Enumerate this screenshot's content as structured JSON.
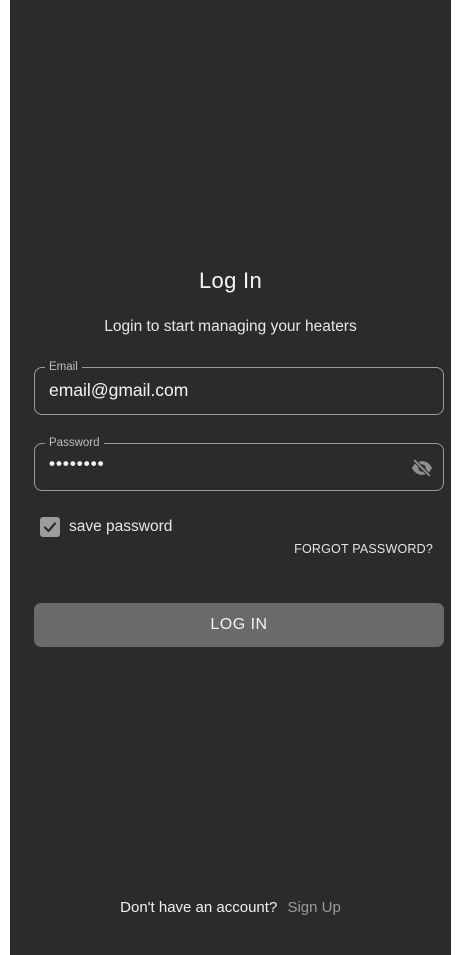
{
  "login": {
    "title": "Log In",
    "subtitle": "Login to start managing your heaters"
  },
  "email_field": {
    "label": "Email",
    "value": "email@gmail.com"
  },
  "password_field": {
    "label": "Password",
    "value": "••••••••",
    "toggle_icon": "eye-off-icon"
  },
  "save_password": {
    "label": "save password",
    "checked": true
  },
  "forgot_password": {
    "label": "FORGOT PASSWORD?"
  },
  "login_button": {
    "label": "LOG IN"
  },
  "signup": {
    "prompt": "Don't have an account?",
    "link": "Sign Up"
  },
  "colors": {
    "background": "#2b2b2b",
    "button": "#6a6a6a",
    "border": "#9a9a9a",
    "link": "#9a9a9a"
  }
}
